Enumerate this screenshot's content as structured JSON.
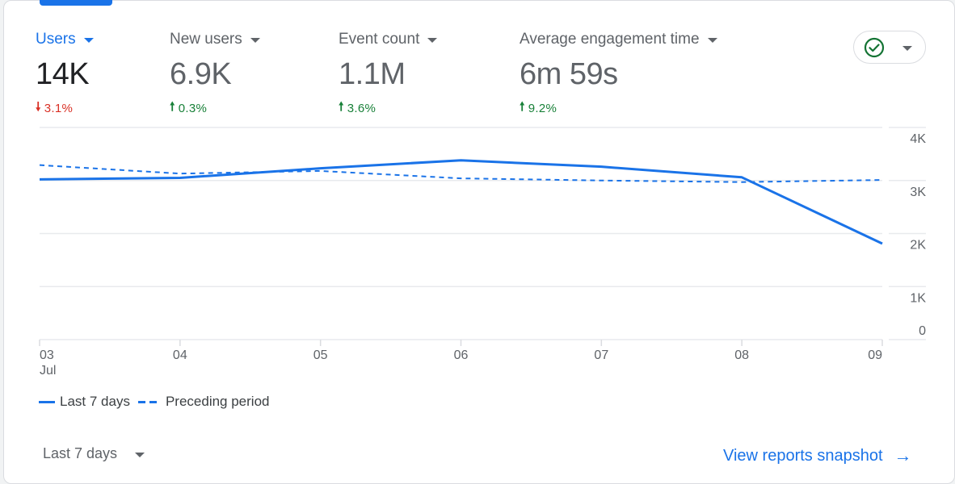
{
  "metrics": [
    {
      "label": "Users",
      "value": "14K",
      "change": "3.1%",
      "direction": "down",
      "active": true
    },
    {
      "label": "New users",
      "value": "6.9K",
      "change": "0.3%",
      "direction": "up"
    },
    {
      "label": "Event count",
      "value": "1.1M",
      "change": "3.6%",
      "direction": "up"
    },
    {
      "label": "Average engagement time",
      "value": "6m 59s",
      "change": "9.2%",
      "direction": "up"
    }
  ],
  "arrows": {
    "up": "🠕",
    "down": "🠗"
  },
  "status_icon": "check-circle-icon",
  "colors": {
    "accent": "#1a73e8",
    "up": "#188038",
    "down": "#d93025",
    "grid": "#e8eaed"
  },
  "chart_data": {
    "type": "line",
    "title": "",
    "xlabel": "",
    "ylabel": "",
    "x": [
      "03",
      "04",
      "05",
      "06",
      "07",
      "08",
      "09"
    ],
    "x_sublabel_first": "Jul",
    "y_ticks": [
      "0",
      "1K",
      "2K",
      "3K",
      "4K"
    ],
    "y_tick_values": [
      0,
      1000,
      2000,
      3000,
      4000
    ],
    "ylim": [
      0,
      4000
    ],
    "grid": true,
    "y_axis_side": "right",
    "legend_position": "bottom-left",
    "series": [
      {
        "name": "Last 7 days",
        "style": "solid",
        "values": [
          3020,
          3050,
          3230,
          3380,
          3260,
          3060,
          1810
        ]
      },
      {
        "name": "Preceding period",
        "style": "dashed",
        "values": [
          3290,
          3130,
          3180,
          3040,
          3000,
          2970,
          3010
        ]
      }
    ]
  },
  "legend": {
    "solid_label": "Last 7 days",
    "dashed_label": "Preceding period"
  },
  "footer": {
    "date_range": "Last 7 days",
    "view_link": "View reports snapshot",
    "view_arrow": "→"
  }
}
